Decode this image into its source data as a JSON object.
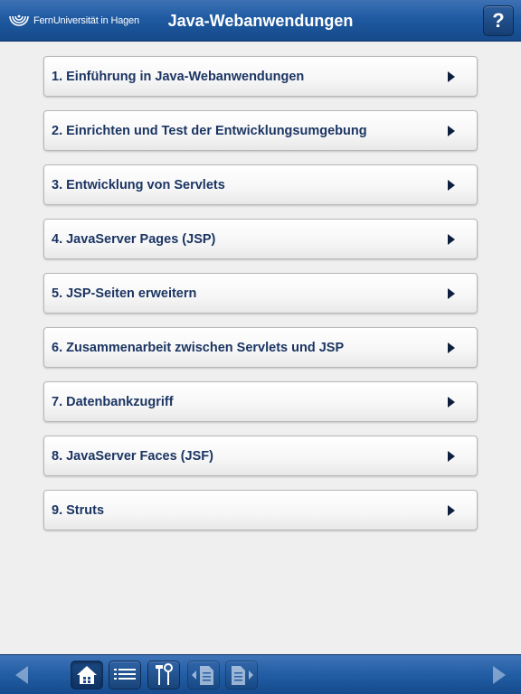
{
  "header": {
    "logo_text": "FernUniversität in Hagen",
    "title": "Java-Webanwendungen",
    "help_label": "?"
  },
  "chapters": [
    {
      "label": "1. Einführung in Java-Webanwendungen"
    },
    {
      "label": "2. Einrichten und Test der Entwicklungsumgebung"
    },
    {
      "label": "3. Entwicklung von Servlets"
    },
    {
      "label": "4. JavaServer Pages (JSP)"
    },
    {
      "label": "5. JSP-Seiten erweitern"
    },
    {
      "label": "6. Zusammenarbeit zwischen Servlets und JSP"
    },
    {
      "label": "7. Datenbankzugriff"
    },
    {
      "label": "8. JavaServer Faces (JSF)"
    },
    {
      "label": "9. Struts"
    }
  ],
  "toolbar": {
    "icons": [
      "back-arrow-icon",
      "home-icon",
      "list-icon",
      "tools-icon",
      "previous-page-icon",
      "next-page-icon",
      "forward-arrow-icon"
    ]
  },
  "colors": {
    "header_blue": "#1f5aa1",
    "item_text": "#1b3563",
    "background": "#efefef"
  }
}
